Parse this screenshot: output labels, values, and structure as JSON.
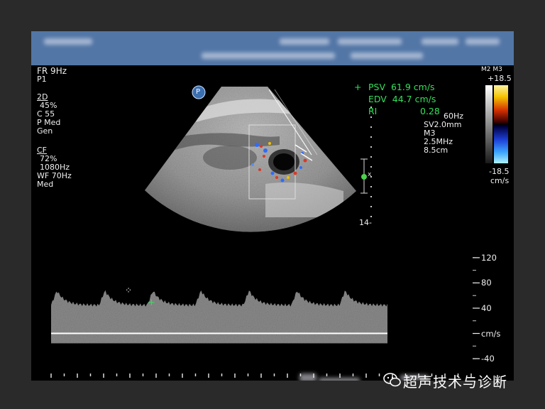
{
  "left_params": {
    "fr": "FR 9Hz",
    "p": "P1",
    "mode_2d": "2D",
    "gain_2d": "45%",
    "c": "C 55",
    "pmed": "P Med",
    "gen": "Gen",
    "mode_cf": "CF",
    "cf_gain": "72%",
    "prf": "1080Hz",
    "wf": "WF 70Hz",
    "med": "Med"
  },
  "measurements": {
    "psv": "PSV  61.9 cm/s",
    "edv": "EDV  44.7 cm/s",
    "ri": "RI",
    "ri_value": "0.28"
  },
  "right_params": {
    "freq60": "60Hz",
    "sv": "SV2.0mm",
    "m3": "M3",
    "mhz": "2.5MHz",
    "depth": "8.5cm"
  },
  "colorbar": {
    "header": "M2 M3",
    "max": "+18.5",
    "min": "-18.5",
    "unit": "cm/s"
  },
  "depth_scale": {
    "max_label": "14-"
  },
  "probe_badge": "P",
  "velocity_scale": {
    "ticks": [
      {
        "value": 120,
        "label": "120"
      },
      {
        "value": 80,
        "label": "80"
      },
      {
        "value": 40,
        "label": "40"
      },
      {
        "value": 0,
        "label": "cm/s"
      },
      {
        "value": -40,
        "label": "-40"
      }
    ],
    "range": [
      -50,
      130
    ]
  },
  "spectrum": {
    "peak_velocity": 61.9,
    "end_diastolic_velocity": 44.7,
    "cycles": 7
  },
  "watermark": "超声技术与诊断",
  "colors": {
    "header_bg": "#5276a6",
    "measure_green": "#33e05a"
  }
}
